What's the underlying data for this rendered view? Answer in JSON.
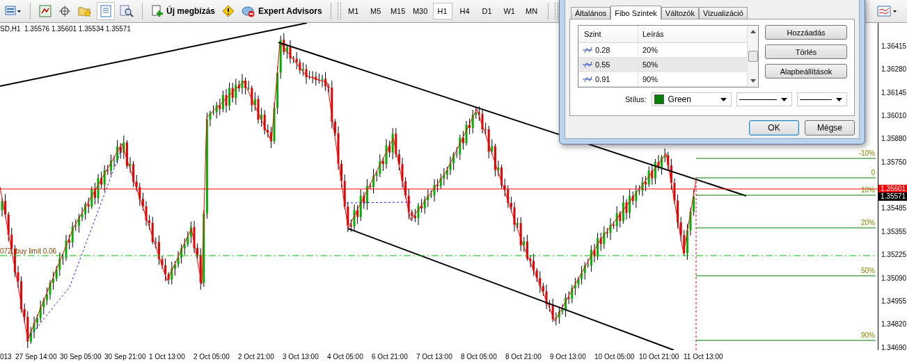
{
  "toolbar": {
    "new_order": "Új megbízás",
    "expert_advisors": "Expert Advisors",
    "timeframes": [
      {
        "label": "M1",
        "selected": false
      },
      {
        "label": "M5",
        "selected": false
      },
      {
        "label": "M15",
        "selected": false
      },
      {
        "label": "M30",
        "selected": false
      },
      {
        "label": "H1",
        "selected": true
      },
      {
        "label": "H4",
        "selected": false
      },
      {
        "label": "D1",
        "selected": false
      },
      {
        "label": "W1",
        "selected": false
      },
      {
        "label": "MN",
        "selected": false
      }
    ]
  },
  "chart": {
    "header": "SD,H1  1.35576 1.35601 1.35534 1.35571",
    "order_label": "072  buy limit 0.06",
    "fibo_levels": [
      {
        "label": "-10%"
      },
      {
        "label": "0"
      },
      {
        "label": "10%"
      },
      {
        "label": "20%"
      },
      {
        "label": "50%"
      },
      {
        "label": "90%"
      }
    ],
    "price_ticks": [
      "1.36415",
      "1.36280",
      "1.36145",
      "1.36010",
      "1.35880",
      "1.35750",
      "1.35485",
      "1.35355",
      "1.35225",
      "1.35090",
      "1.34955",
      "1.34820",
      "1.34690"
    ],
    "price_markers": [
      {
        "value": "1.35601",
        "kind": "line"
      },
      {
        "value": "1.35571",
        "kind": "bid"
      }
    ],
    "time_ticks": [
      "013",
      "27 Sep 14:00",
      "30 Sep 05:00",
      "30 Sep 21:00",
      "1 Oct 13:00",
      "2 Oct 05:00",
      "2 Oct 21:00",
      "3 Oct 13:00",
      "4 Oct 05:00",
      "6 Oct 21:00",
      "7 Oct 13:00",
      "8 Oct 05:00",
      "8 Oct 21:00",
      "9 Oct 13:00",
      "10 Oct 05:00",
      "10 Oct 21:00",
      "11 Oct 13:00"
    ]
  },
  "dialog": {
    "tabs": [
      {
        "label": "Általános",
        "selected": false
      },
      {
        "label": "Fibo Szintek",
        "selected": true
      },
      {
        "label": "Változók",
        "selected": false
      },
      {
        "label": "Vizualizáció",
        "selected": false
      }
    ],
    "levels_table": {
      "columns": [
        "Szint",
        "Leírás"
      ],
      "rows": [
        {
          "level": "0.28",
          "description": "20%",
          "selected": false
        },
        {
          "level": "0.55",
          "description": "50%",
          "selected": true
        },
        {
          "level": "0.91",
          "description": "90%",
          "selected": false
        }
      ]
    },
    "buttons": [
      "Hozzáadás",
      "Törlés",
      "Alapbeállítások"
    ],
    "style": {
      "label": "Stílus:",
      "color_name": "Green",
      "color": "#008000"
    },
    "footer_buttons": [
      "OK",
      "Mégse"
    ]
  }
}
